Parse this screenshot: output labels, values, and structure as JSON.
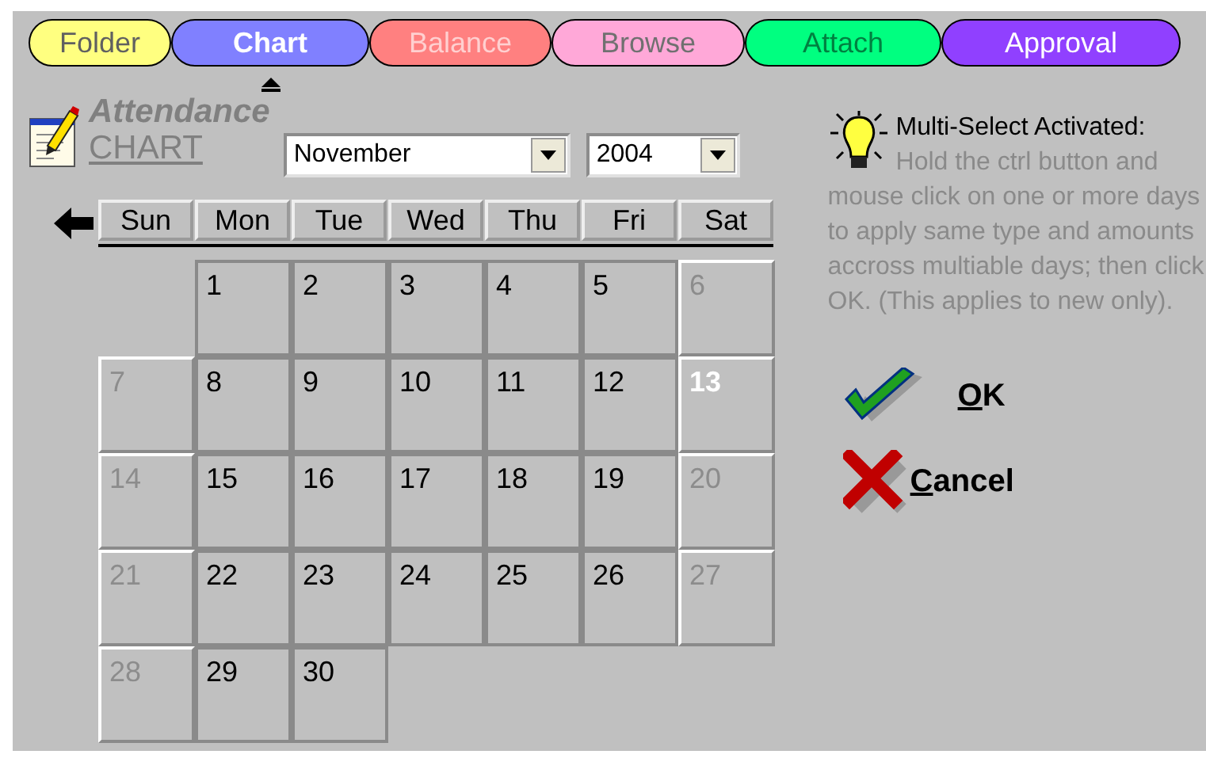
{
  "tabs": [
    {
      "label": "Folder",
      "color": "#ffff80",
      "selected": false
    },
    {
      "label": "Chart",
      "color": "#8080ff",
      "selected": true
    },
    {
      "label": "Balance",
      "color": "#ff8080",
      "selected": false
    },
    {
      "label": "Browse",
      "color": "#ffa8d8",
      "selected": false
    },
    {
      "label": "Attach",
      "color": "#00ff80",
      "selected": false
    },
    {
      "label": "Approval",
      "color": "#9040ff",
      "selected": false
    }
  ],
  "title": {
    "line1": "Attendance",
    "line2": "CHART"
  },
  "month": {
    "value": "November"
  },
  "year": {
    "value": "2004"
  },
  "weekdays": [
    "Sun",
    "Mon",
    "Tue",
    "Wed",
    "Thu",
    "Fri",
    "Sat"
  ],
  "weeks": [
    [
      {
        "day": "1",
        "kind": "weekday",
        "today": false
      },
      {
        "day": "2",
        "kind": "weekday",
        "today": false
      },
      {
        "day": "3",
        "kind": "weekday",
        "today": false
      },
      {
        "day": "4",
        "kind": "weekday",
        "today": false
      },
      {
        "day": "5",
        "kind": "weekday",
        "today": false
      },
      {
        "day": "6",
        "kind": "weekend",
        "today": false
      }
    ],
    [
      {
        "day": "7",
        "kind": "weekend",
        "today": false
      },
      {
        "day": "8",
        "kind": "weekday",
        "today": false
      },
      {
        "day": "9",
        "kind": "weekday",
        "today": false
      },
      {
        "day": "10",
        "kind": "weekday",
        "today": false
      },
      {
        "day": "11",
        "kind": "weekday",
        "today": false
      },
      {
        "day": "12",
        "kind": "weekday",
        "today": false
      },
      {
        "day": "13",
        "kind": "weekend",
        "today": true
      }
    ],
    [
      {
        "day": "14",
        "kind": "weekend",
        "today": false
      },
      {
        "day": "15",
        "kind": "weekday",
        "today": false
      },
      {
        "day": "16",
        "kind": "weekday",
        "today": false
      },
      {
        "day": "17",
        "kind": "weekday",
        "today": false
      },
      {
        "day": "18",
        "kind": "weekday",
        "today": false
      },
      {
        "day": "19",
        "kind": "weekday",
        "today": false
      },
      {
        "day": "20",
        "kind": "weekend",
        "today": false
      }
    ],
    [
      {
        "day": "21",
        "kind": "weekend",
        "today": false
      },
      {
        "day": "22",
        "kind": "weekday",
        "today": false
      },
      {
        "day": "23",
        "kind": "weekday",
        "today": false
      },
      {
        "day": "24",
        "kind": "weekday",
        "today": false
      },
      {
        "day": "25",
        "kind": "weekday",
        "today": false
      },
      {
        "day": "26",
        "kind": "weekday",
        "today": false
      },
      {
        "day": "27",
        "kind": "weekend",
        "today": false
      }
    ],
    [
      {
        "day": "28",
        "kind": "weekend",
        "today": false
      },
      {
        "day": "29",
        "kind": "weekday",
        "today": false
      },
      {
        "day": "30",
        "kind": "weekday",
        "today": false
      }
    ]
  ],
  "help": {
    "title": "Multi-Select Activated:",
    "text": "Hold the ctrl button and mouse click on one or more days to apply same type and amounts accross multiable days; then click OK.  (This applies to new only)."
  },
  "buttons": [
    {
      "kind": "ok",
      "label": "OK"
    },
    {
      "kind": "cancel",
      "label": "Cancel"
    }
  ]
}
